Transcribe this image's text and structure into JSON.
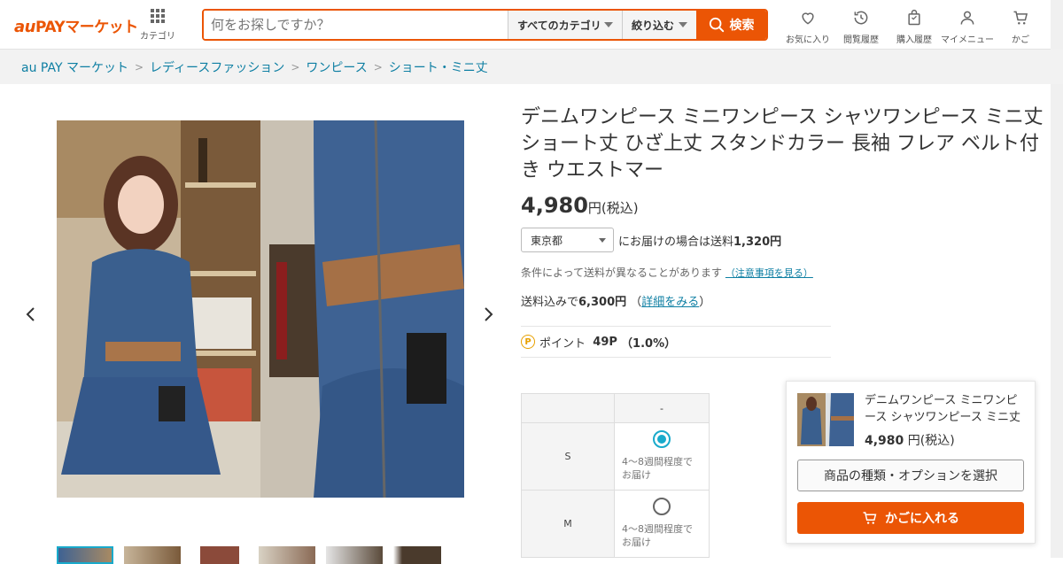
{
  "header": {
    "logo_au": "au",
    "logo_text": "PAYマーケット",
    "category_label": "カテゴリ",
    "search_placeholder": "何をお探しですか？",
    "category_select": "すべてのカテゴリ",
    "filter_select": "絞り込む",
    "search_button": "検索",
    "nav": [
      {
        "label": "お気に入り",
        "icon": "heart-icon"
      },
      {
        "label": "閲覧履歴",
        "icon": "history-icon"
      },
      {
        "label": "購入履歴",
        "icon": "shopping-bag-icon"
      },
      {
        "label": "マイメニュー",
        "icon": "user-icon"
      },
      {
        "label": "かご",
        "icon": "cart-icon"
      }
    ]
  },
  "breadcrumb": [
    "au PAY マーケット",
    "レディースファッション",
    "ワンピース",
    "ショート・ミニ丈"
  ],
  "product": {
    "title": "デニムワンピース ミニワンピース シャツワンピース ミニ丈 ショート丈 ひざ上丈 スタンドカラー 長袖 フレア ベルト付き ウエストマー",
    "price": "4,980",
    "price_unit": "円(税込)",
    "prefecture": "東京都",
    "shipping_text": "にお届けの場合は送料",
    "shipping_fee": "1,320円",
    "note": "条件によって送料が異なることがあります",
    "note_link": "（注意事項を見る）",
    "total_label": "送料込みで",
    "total_value": "6,300円",
    "total_link": "詳細をみる",
    "points_label": "ポイント",
    "points_value": "49P",
    "points_rate": "（1.0%）"
  },
  "options": {
    "column_header": "-",
    "rows": [
      {
        "size": "S",
        "selected": true,
        "delivery": "4～8週間程度でお届け"
      },
      {
        "size": "M",
        "selected": false,
        "delivery": "4～8週間程度でお届け"
      }
    ]
  },
  "cart": {
    "title": "デニムワンピース ミニワンピース シャツワンピース ミニ丈 ショート丈",
    "price": "4,980",
    "price_unit": " 円(税込)",
    "option_button": "商品の種類・オプションを選択",
    "add_button": "かごに入れる"
  },
  "colors": {
    "accent": "#eb5505",
    "link": "#0e7fa3",
    "radio": "#19aacb"
  }
}
